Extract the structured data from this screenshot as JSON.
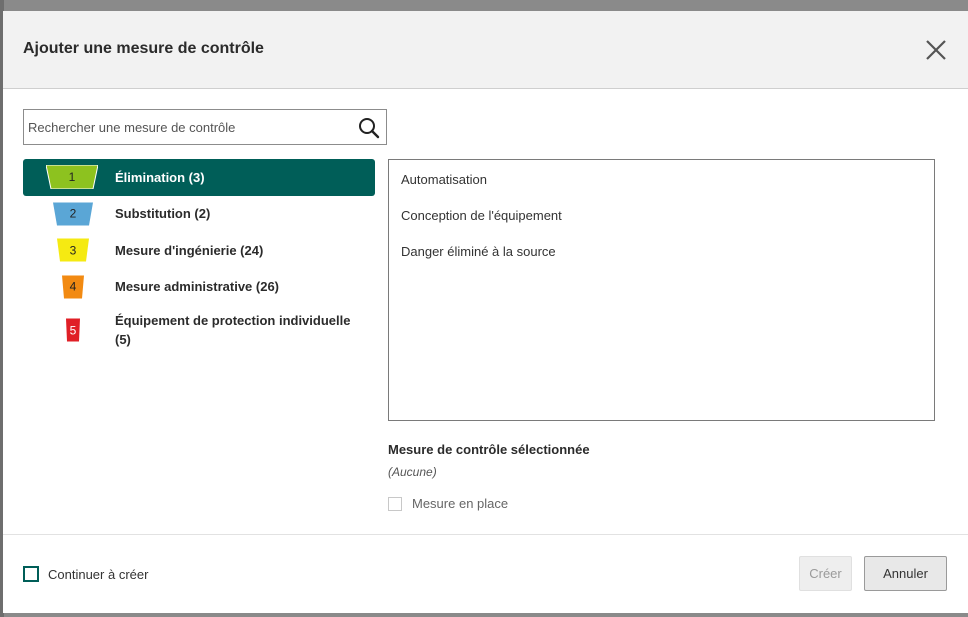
{
  "dialog": {
    "title": "Ajouter une mesure de contrôle"
  },
  "search": {
    "placeholder": "Rechercher une mesure de contrôle"
  },
  "categories": [
    {
      "number": "1",
      "label": "Élimination (3)",
      "color": "#8dc21f",
      "selected": true
    },
    {
      "number": "2",
      "label": "Substitution (2)",
      "color": "#5aa6d6",
      "selected": false
    },
    {
      "number": "3",
      "label": "Mesure d'ingénierie (24)",
      "color": "#f5ea12",
      "selected": false
    },
    {
      "number": "4",
      "label": "Mesure administrative (26)",
      "color": "#f28a12",
      "selected": false
    },
    {
      "number": "5",
      "label": "Équipement de protection individuelle (5)",
      "color": "#e01f26",
      "selected": false
    }
  ],
  "options": [
    "Automatisation",
    "Conception de l'équipement",
    "Danger éliminé à la source"
  ],
  "selection": {
    "title": "Mesure de contrôle sélectionnée",
    "value": "(Aucune)",
    "in_place_label": "Mesure en place"
  },
  "footer": {
    "continue_label": "Continuer à créer",
    "create_label": "Créer",
    "cancel_label": "Annuler"
  },
  "colors": {
    "accent": "#005e58"
  }
}
